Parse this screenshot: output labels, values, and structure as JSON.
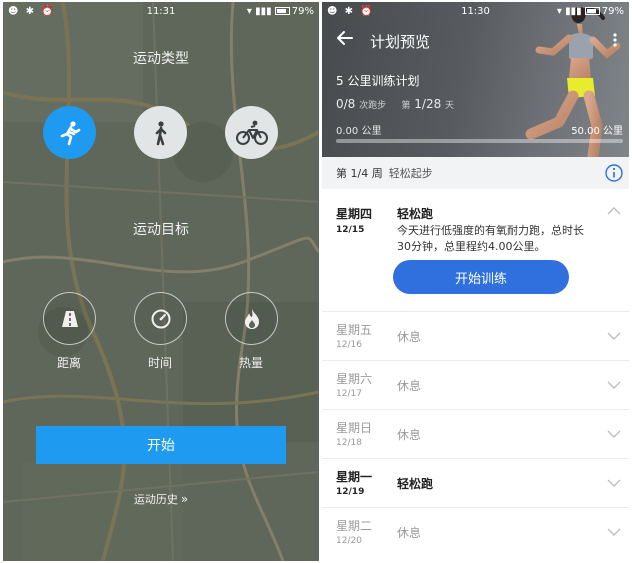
{
  "left": {
    "status": {
      "left_icons": "☻ ✱ ⏰",
      "time": "11:31",
      "battery": "79%"
    },
    "sport_type_title": "运动类型",
    "sport_types": [
      {
        "name": "run",
        "icon": "runner-icon",
        "selected": true
      },
      {
        "name": "walk",
        "icon": "walker-icon",
        "selected": false
      },
      {
        "name": "bike",
        "icon": "cyclist-icon",
        "selected": false
      }
    ],
    "goal_title": "运动目标",
    "goals": [
      {
        "label": "距离",
        "icon": "road-icon"
      },
      {
        "label": "时间",
        "icon": "stopwatch-icon"
      },
      {
        "label": "热量",
        "icon": "flame-icon"
      }
    ],
    "start_label": "开始",
    "history_label": "运动历史",
    "accent_color": "#1e9bf0"
  },
  "right": {
    "status": {
      "left_icons": "☻ ✱ ⏰",
      "time": "11:30",
      "battery": "79%"
    },
    "header_title": "计划预览",
    "plan_name": "5 公里训练计划",
    "runs_value": "0/8",
    "runs_unit": "次跑步",
    "day_prefix": "第",
    "day_value": "1/28",
    "day_unit": "天",
    "distance_start": "0.00 公里",
    "distance_end": "50.00 公里",
    "distance_progress": 0,
    "week_label": "第 1/4 周",
    "week_theme": "轻松起步",
    "days": [
      {
        "name": "星期四",
        "date": "12/15",
        "activity": "轻松跑",
        "active": true,
        "expanded": true,
        "description": "今天进行低强度的有氧耐力跑，总时长30分钟，总里程约4.00公里。",
        "button": "开始训练"
      },
      {
        "name": "星期五",
        "date": "12/16",
        "activity": "休息",
        "active": false
      },
      {
        "name": "星期六",
        "date": "12/17",
        "activity": "休息",
        "active": false
      },
      {
        "name": "星期日",
        "date": "12/18",
        "activity": "休息",
        "active": false
      },
      {
        "name": "星期一",
        "date": "12/19",
        "activity": "轻松跑",
        "active": true
      },
      {
        "name": "星期二",
        "date": "12/20",
        "activity": "休息",
        "active": false
      }
    ],
    "button_color": "#2f6fde"
  }
}
